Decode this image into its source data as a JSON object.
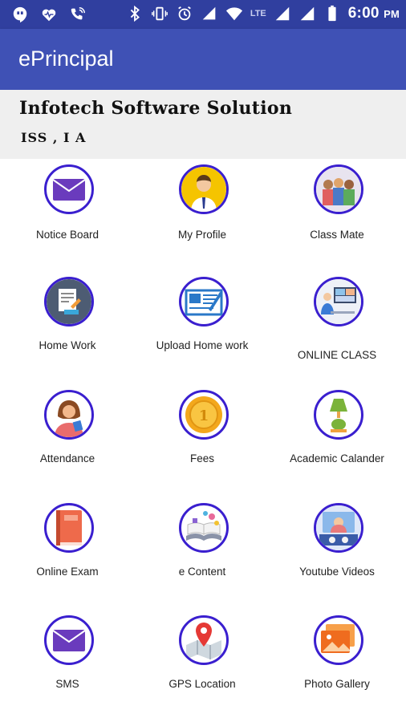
{
  "status_bar": {
    "time": "6:00",
    "ampm": "PM",
    "network": "LTE",
    "network_4g": "4G"
  },
  "app_bar": {
    "title": "ePrincipal"
  },
  "school": {
    "name": "Infotech Software Solution",
    "class": "ISS , I A"
  },
  "menu": [
    {
      "label": "Notice Board",
      "icon": "envelope-icon"
    },
    {
      "label": "My Profile",
      "icon": "profile-icon"
    },
    {
      "label": "Class Mate",
      "icon": "classmates-icon"
    },
    {
      "label": "Home Work",
      "icon": "homework-icon"
    },
    {
      "label": "Upload Home work",
      "icon": "upload-homework-icon"
    },
    {
      "label": "ONLINE CLASS",
      "icon": "online-class-icon"
    },
    {
      "label": "Attendance",
      "icon": "attendance-icon"
    },
    {
      "label": "Fees",
      "icon": "coin-icon"
    },
    {
      "label": "Academic Calander",
      "icon": "lamp-icon"
    },
    {
      "label": "Online Exam",
      "icon": "book-icon"
    },
    {
      "label": "e Content",
      "icon": "open-book-icon"
    },
    {
      "label": "Youtube Videos",
      "icon": "video-icon"
    },
    {
      "label": "SMS",
      "icon": "envelope-icon"
    },
    {
      "label": "GPS Location",
      "icon": "map-pin-icon"
    },
    {
      "label": "Photo Gallery",
      "icon": "gallery-icon"
    }
  ],
  "colors": {
    "status_bar": "#303f9f",
    "app_bar": "#3f51b5",
    "header_bg": "#efefef",
    "icon_ring": "#3a1fcf"
  }
}
